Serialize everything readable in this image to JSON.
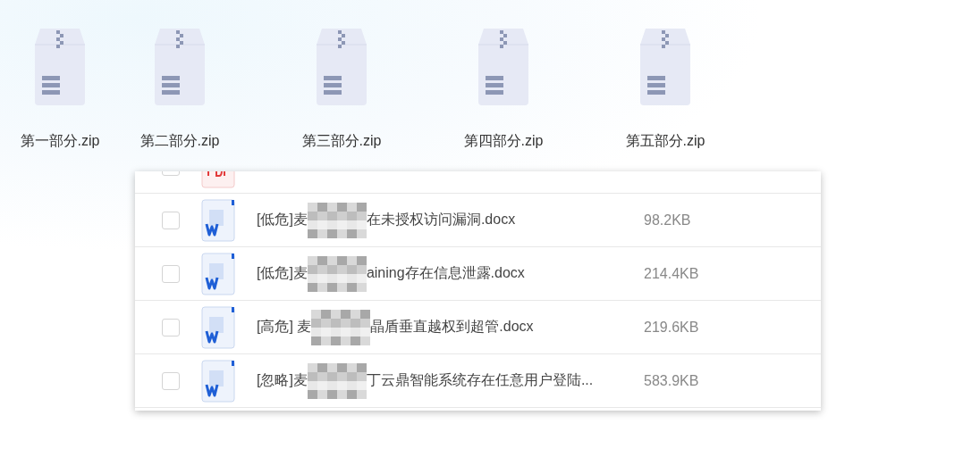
{
  "archives": [
    {
      "label": "第一部分.zip"
    },
    {
      "label": "第二部分.zip"
    },
    {
      "label": "第三部分.zip"
    },
    {
      "label": "第四部分.zip"
    },
    {
      "label": "第五部分.zip"
    }
  ],
  "files": [
    {
      "kind": "pdf",
      "checked": false
    },
    {
      "kind": "word",
      "checked": false,
      "name_start": "[低危]麦",
      "name_end": "在未授权访问漏洞.docx",
      "size": "98.2KB"
    },
    {
      "kind": "word",
      "checked": false,
      "name_start": "[低危]麦",
      "name_end": "aining存在信息泄露.docx",
      "size": "214.4KB"
    },
    {
      "kind": "word",
      "checked": false,
      "name_start": "[高危] 麦",
      "name_end": "晶盾垂直越权到超管.docx",
      "size": "219.6KB"
    },
    {
      "kind": "word",
      "checked": false,
      "name_start": "[忽略]麦",
      "name_end": "丁云鼎智能系统存在任意用户登陆...",
      "size": "583.9KB"
    }
  ]
}
